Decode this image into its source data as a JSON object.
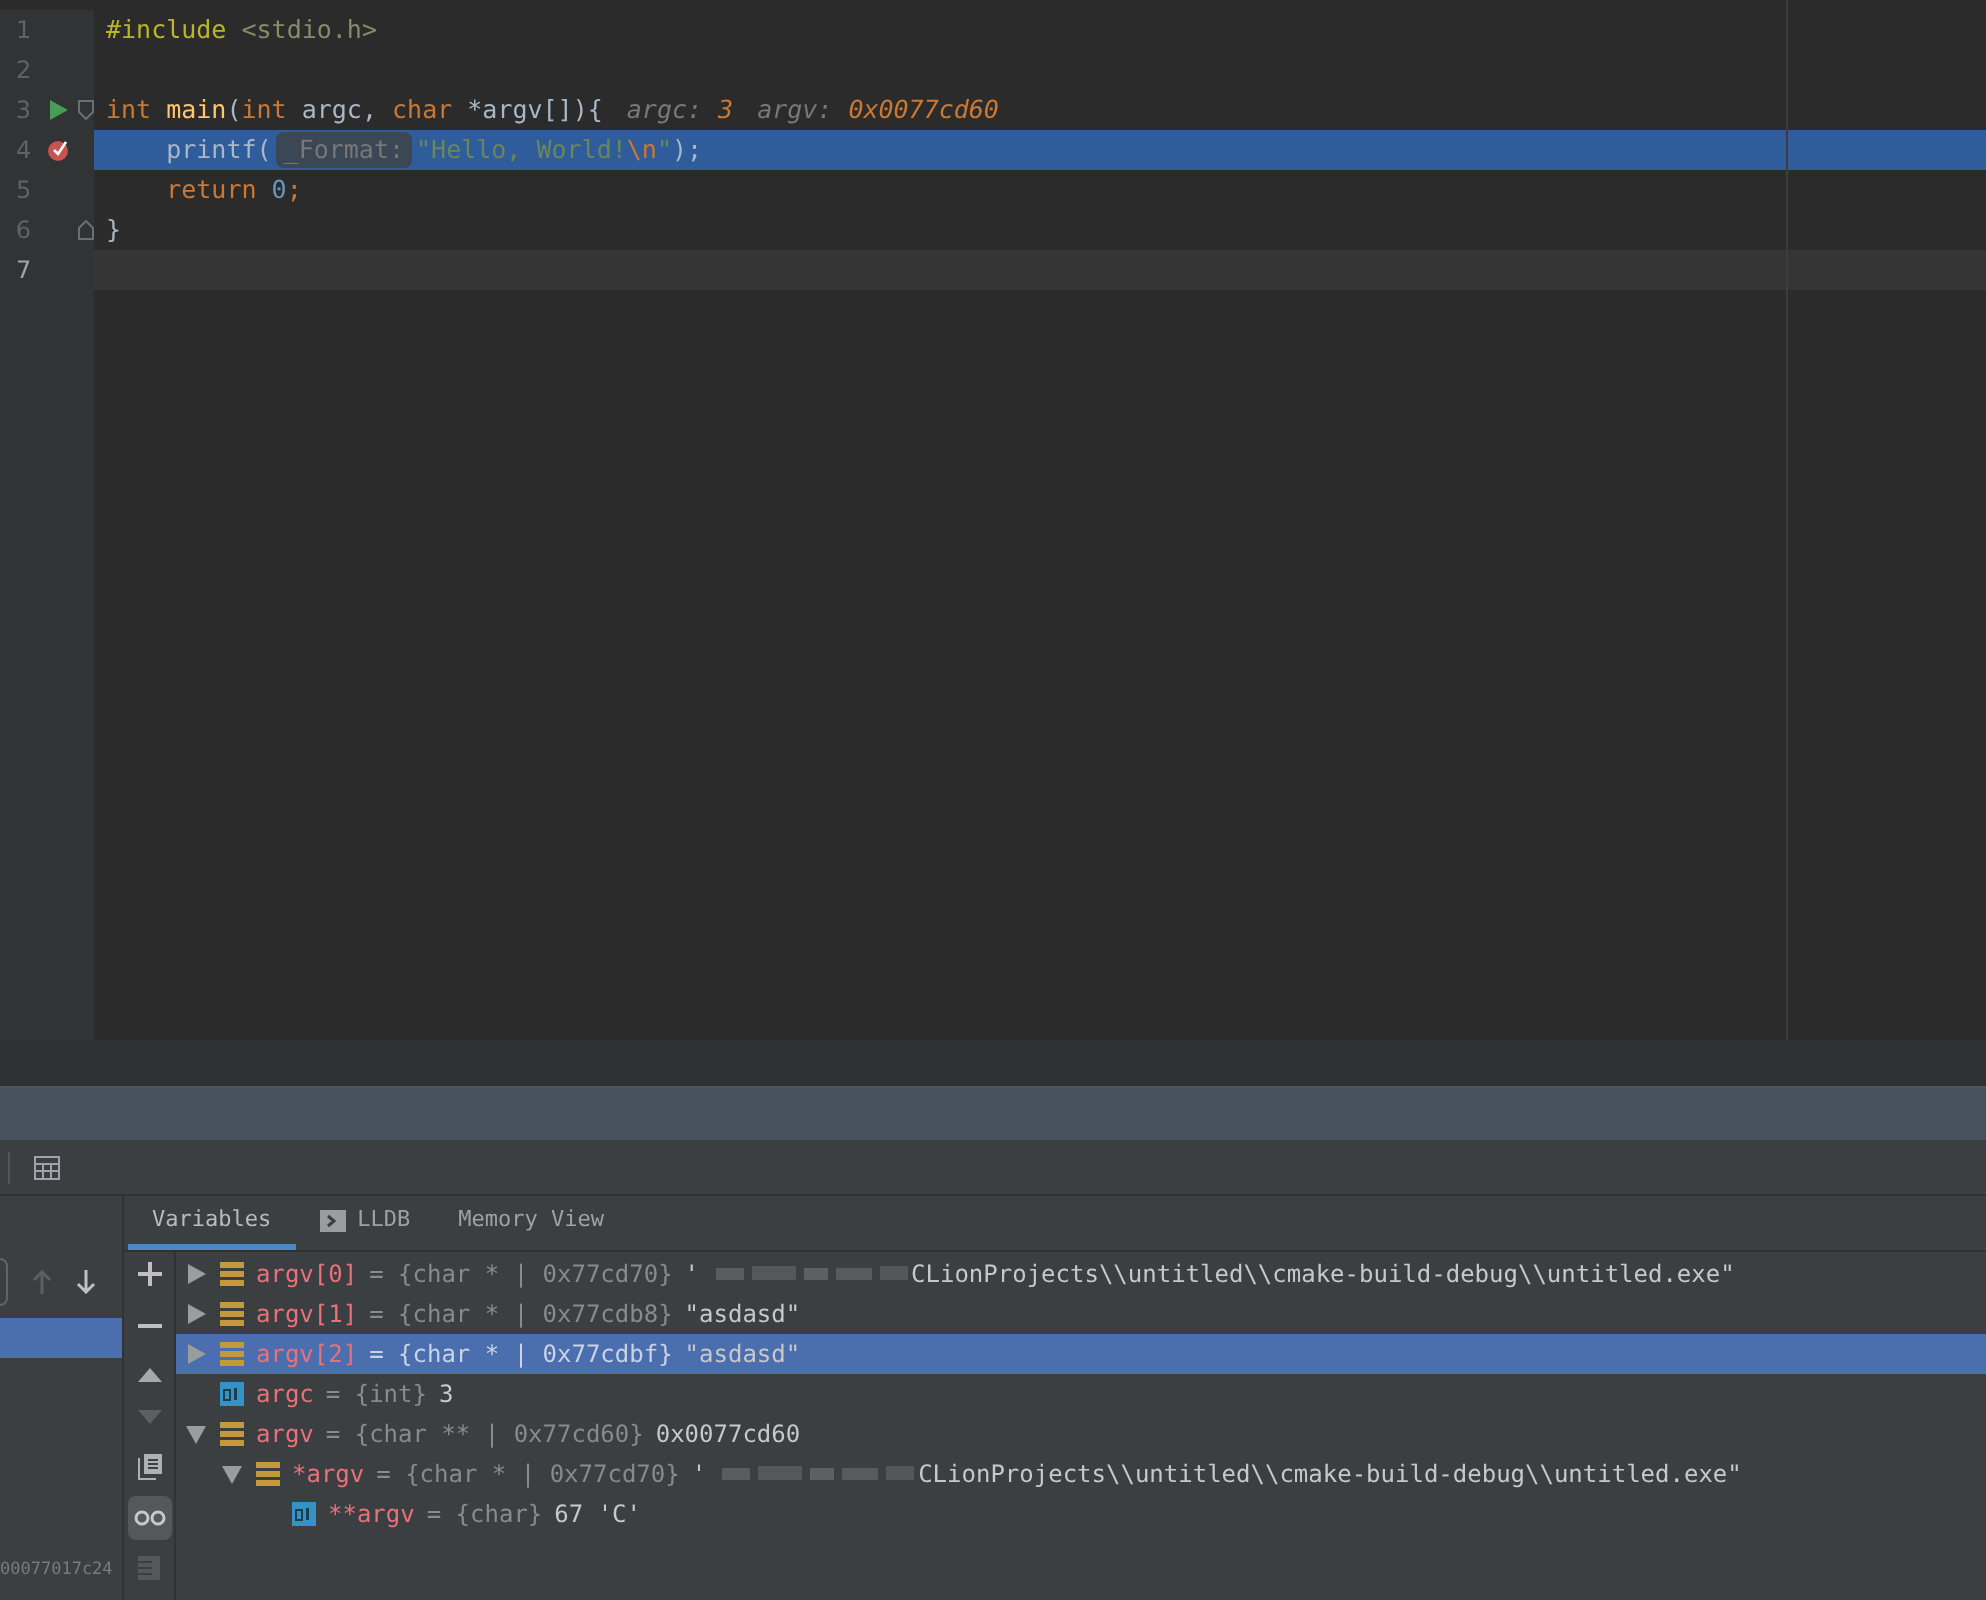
{
  "editor": {
    "lines": [
      {
        "number": "1",
        "tokens": [
          {
            "kind": "directive",
            "text": "#include"
          },
          {
            "kind": "header",
            "text": " <stdio.h>"
          }
        ]
      },
      {
        "number": "2"
      },
      {
        "number": "3",
        "run_marker": true,
        "fold_start": true,
        "tokens": [
          {
            "kind": "keyword",
            "text": "int"
          },
          {
            "kind": "func",
            "text": " main"
          },
          {
            "kind": "plain",
            "text": "("
          },
          {
            "kind": "keyword",
            "text": "int"
          },
          {
            "kind": "plain",
            "text": " argc, "
          },
          {
            "kind": "keyword",
            "text": "char"
          },
          {
            "kind": "plain",
            "text": " *argv[]){"
          },
          {
            "kind": "hint-name",
            "text": "argc:"
          },
          {
            "kind": "hint-value",
            "text": "3"
          },
          {
            "kind": "hint-name",
            "text": "argv:"
          },
          {
            "kind": "hint-value",
            "text": "0x0077cd60"
          }
        ]
      },
      {
        "number": "4",
        "breakpoint": true,
        "highlighted": true,
        "tokens": [
          {
            "kind": "plain",
            "text": "    printf("
          },
          {
            "kind": "param-hint",
            "text": "_Format:"
          },
          {
            "kind": "string",
            "text": "\"Hello, World!"
          },
          {
            "kind": "escape",
            "text": "\\n"
          },
          {
            "kind": "string",
            "text": "\""
          },
          {
            "kind": "plain",
            "text": ");"
          }
        ]
      },
      {
        "number": "5",
        "tokens": [
          {
            "kind": "keyword",
            "text": "    return"
          },
          {
            "kind": "number",
            "text": " 0"
          },
          {
            "kind": "keyword",
            "text": ";"
          }
        ]
      },
      {
        "number": "6",
        "fold_end": true,
        "tokens": [
          {
            "kind": "plain",
            "text": "}"
          }
        ]
      },
      {
        "number": "7",
        "current": true
      }
    ]
  },
  "frames": {
    "frame_address": "00077017c24"
  },
  "debug_tabs": [
    {
      "label": "Variables",
      "selected": true
    },
    {
      "label": "LLDB",
      "selected": false
    },
    {
      "label": "Memory View",
      "selected": false
    }
  ],
  "variables": [
    {
      "kind": "array",
      "name": "argv[0]",
      "type": "= {char * | 0x77cd70}",
      "value_prefix": "'",
      "redacted": true,
      "value": "CLionProjects\\\\untitled\\\\cmake-build-debug\\\\untitled.exe\"",
      "expanded": false,
      "selected": false
    },
    {
      "kind": "array",
      "name": "argv[1]",
      "type": "= {char * | 0x77cdb8}",
      "value": "\"asdasd\"",
      "expanded": false,
      "selected": false
    },
    {
      "kind": "array",
      "name": "argv[2]",
      "type": "= {char * | 0x77cdbf}",
      "value": "\"asdasd\"",
      "expanded": false,
      "selected": true
    },
    {
      "kind": "primitive",
      "name": "argc",
      "type": "= {int}",
      "value": "3",
      "selected": false
    },
    {
      "kind": "array",
      "name": "argv",
      "type": "= {char ** | 0x77cd60}",
      "value": "0x0077cd60",
      "expanded": true,
      "selected": false,
      "children": [
        {
          "kind": "array",
          "name": "*argv",
          "type": "= {char * | 0x77cd70}",
          "value_prefix": "'",
          "redacted": true,
          "value": "CLionProjects\\\\untitled\\\\cmake-build-debug\\\\untitled.exe\"",
          "expanded": true,
          "selected": false,
          "children": [
            {
              "kind": "primitive",
              "name": "**argv",
              "type": "= {char}",
              "value": "67 'C'",
              "selected": false
            }
          ]
        }
      ]
    }
  ]
}
